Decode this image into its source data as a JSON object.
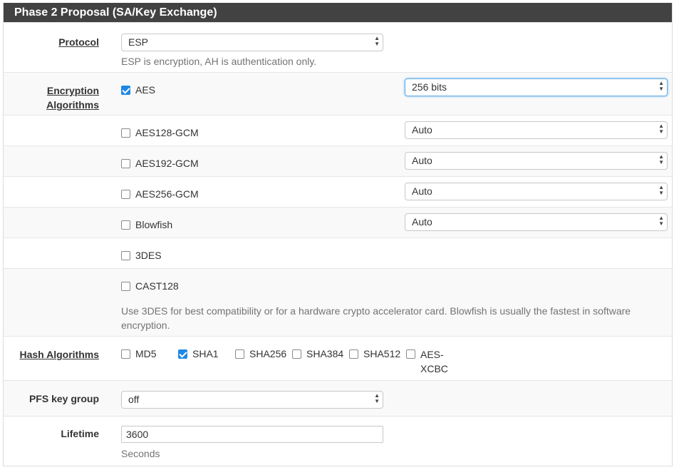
{
  "panel": {
    "title": "Phase 2 Proposal (SA/Key Exchange)"
  },
  "protocol": {
    "label": "Protocol",
    "value": "ESP",
    "help": "ESP is encryption, AH is authentication only."
  },
  "encryption": {
    "label_line1": "Encryption",
    "label_line2": "Algorithms",
    "items": [
      {
        "name": "AES",
        "checked": true,
        "keylen": "256 bits"
      },
      {
        "name": "AES128-GCM",
        "checked": false,
        "keylen": "Auto"
      },
      {
        "name": "AES192-GCM",
        "checked": false,
        "keylen": "Auto"
      },
      {
        "name": "AES256-GCM",
        "checked": false,
        "keylen": "Auto"
      },
      {
        "name": "Blowfish",
        "checked": false,
        "keylen": "Auto"
      },
      {
        "name": "3DES",
        "checked": false
      },
      {
        "name": "CAST128",
        "checked": false
      }
    ],
    "help_line1": "Use 3DES for best compatibility or for a hardware crypto accelerator card. Blowfish is usually the fastest in software",
    "help_line2": "encryption."
  },
  "hash": {
    "label": "Hash Algorithms",
    "items": [
      {
        "name": "MD5",
        "checked": false
      },
      {
        "name": "SHA1",
        "checked": true
      },
      {
        "name": "SHA256",
        "checked": false
      },
      {
        "name": "SHA384",
        "checked": false
      },
      {
        "name": "SHA512",
        "checked": false
      },
      {
        "name_line1": "AES-",
        "name_line2": "XCBC",
        "checked": false
      }
    ]
  },
  "pfs": {
    "label": "PFS key group",
    "value": "off"
  },
  "lifetime": {
    "label": "Lifetime",
    "value": "3600",
    "help": "Seconds"
  },
  "colors": {
    "header_bg": "#424242",
    "checkbox_checked": "#1e88e5",
    "focus": "#66afe9"
  }
}
